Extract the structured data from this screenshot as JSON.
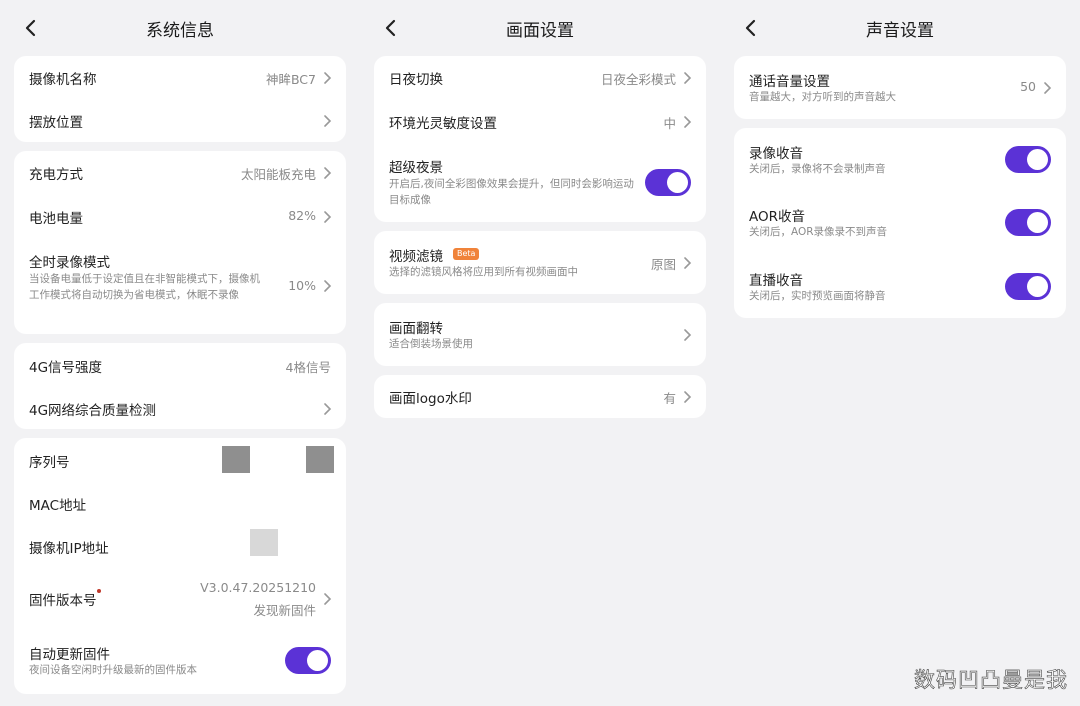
{
  "system": {
    "title": "系统信息",
    "camera_name_label": "摄像机名称",
    "camera_name_value": "神眸BC7",
    "placement_label": "摆放位置",
    "charge_label": "充电方式",
    "charge_value": "太阳能板充电",
    "battery_label": "电池电量",
    "battery_value": "82%",
    "record_mode_label": "全时录像模式",
    "record_mode_desc": "当设备电量低于设定值且在非智能模式下，摄像机工作模式将自动切换为省电模式，休眠不录像",
    "record_mode_value": "10%",
    "signal_label": "4G信号强度",
    "signal_value": "4格信号",
    "network_label": "4G网络综合质量检测",
    "serial_label": "序列号",
    "mac_label": "MAC地址",
    "ip_label": "摄像机IP地址",
    "firmware_label": "固件版本号",
    "firmware_version": "V3.0.47.20251210",
    "firmware_new": "发现新固件",
    "auto_update_label": "自动更新固件",
    "auto_update_desc": "夜间设备空闲时升级最新的固件版本",
    "auto_update_on": true
  },
  "picture": {
    "title": "画面设置",
    "daynight_label": "日夜切换",
    "daynight_value": "日夜全彩模式",
    "ambient_label": "环境光灵敏度设置",
    "ambient_value": "中",
    "supernight_label": "超级夜景",
    "supernight_desc": "开启后,夜间全彩图像效果会提升，但同时会影响运动目标成像",
    "supernight_on": true,
    "filter_label": "视频滤镜",
    "filter_badge": "Beta",
    "filter_desc": "选择的滤镜风格将应用到所有视频画面中",
    "filter_value": "原图",
    "flip_label": "画面翻转",
    "flip_desc": "适合倒装场景使用",
    "logo_label": "画面logo水印",
    "logo_value": "有"
  },
  "sound": {
    "title": "声音设置",
    "call_volume_label": "通话音量设置",
    "call_volume_desc": "音量越大，对方听到的声音越大",
    "call_volume_value": "50",
    "record_audio_label": "录像收音",
    "record_audio_desc": "关闭后，录像将不会录制声音",
    "aor_label": "AOR收音",
    "aor_desc": "关闭后，AOR录像录不到声音",
    "live_label": "直播收音",
    "live_desc": "关闭后，实时预览画面将静音"
  },
  "watermark": "数码凹凸曼是我",
  "colors": {
    "accent": "#5b32d6",
    "badge": "#f0833a",
    "background": "#f2f2f4"
  },
  "icons": {
    "back": "back-arrow-icon",
    "chevron": "chevron-right-icon"
  }
}
